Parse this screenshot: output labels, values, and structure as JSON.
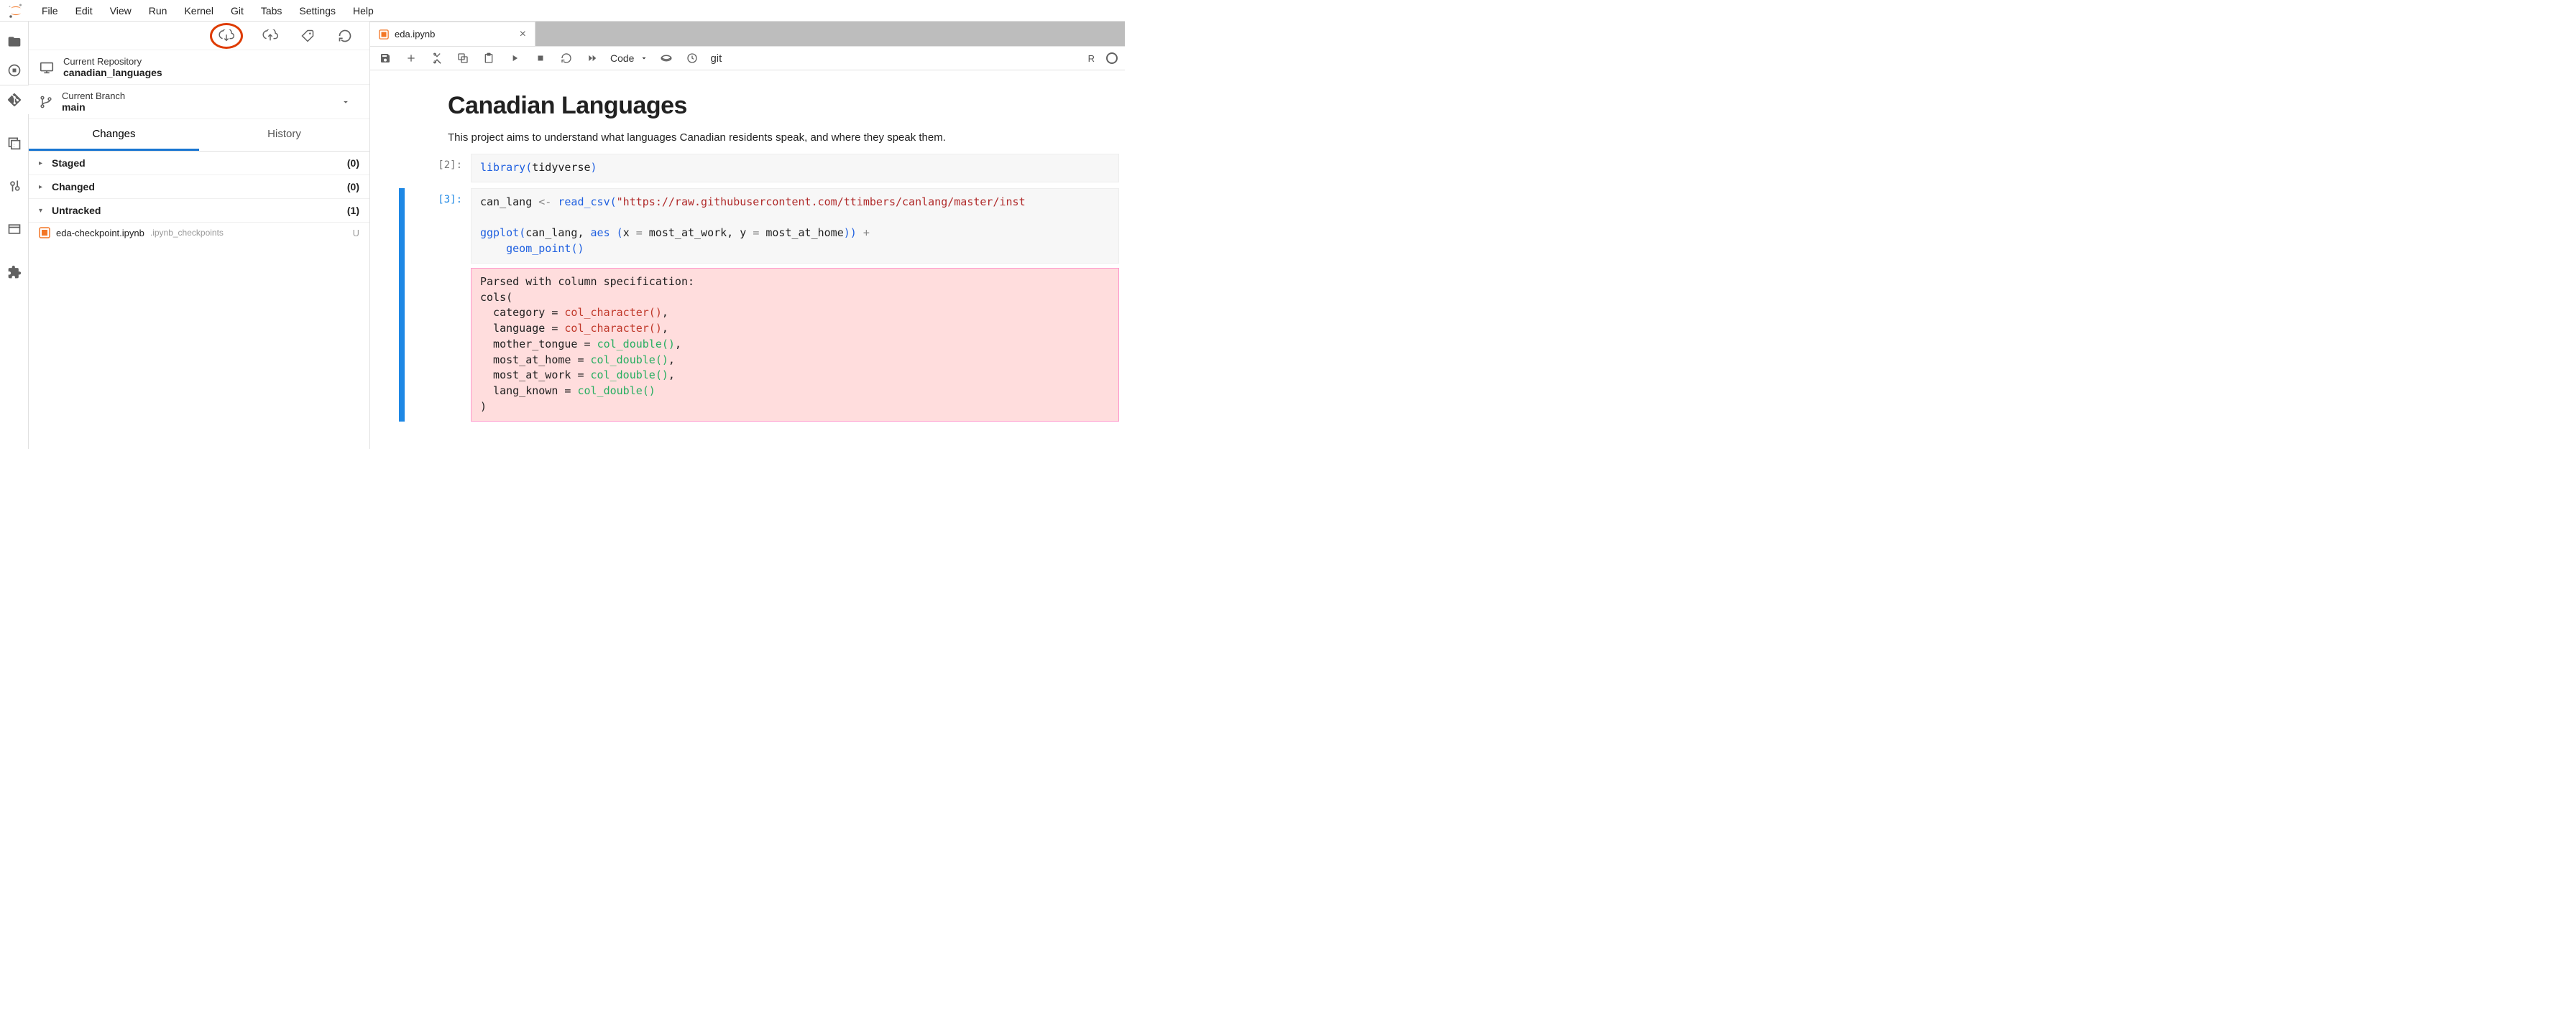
{
  "menubar": {
    "items": [
      "File",
      "Edit",
      "View",
      "Run",
      "Kernel",
      "Git",
      "Tabs",
      "Settings",
      "Help"
    ]
  },
  "git_panel": {
    "repo_label": "Current Repository",
    "repo_name": "canadian_languages",
    "branch_label": "Current Branch",
    "branch_name": "main",
    "tabs": {
      "changes": "Changes",
      "history": "History"
    },
    "sections": {
      "staged": {
        "title": "Staged",
        "count": "(0)",
        "expanded": true
      },
      "changed": {
        "title": "Changed",
        "count": "(0)",
        "expanded": true
      },
      "untracked": {
        "title": "Untracked",
        "count": "(1)",
        "expanded": true
      }
    },
    "untracked_files": [
      {
        "name": "eda-checkpoint.ipynb",
        "subdir": ".ipynb_checkpoints",
        "status": "U"
      }
    ]
  },
  "tab": {
    "title": "eda.ipynb"
  },
  "nb_toolbar": {
    "cell_type": "Code",
    "git_label": "git",
    "kernel_short": "R"
  },
  "notebook": {
    "title": "Canadian Languages",
    "intro": "This project aims to understand what languages Canadian residents speak, and where they speak them.",
    "cells": [
      {
        "prompt": "[2]:",
        "code_html": "<span class='tok-fn'>library</span><span class='tok-paren'>(</span>tidyverse<span class='tok-paren'>)</span>"
      },
      {
        "prompt": "[3]:",
        "active": true,
        "code_html": "can_lang <span class='tok-op'>&lt;-</span> <span class='tok-fn'>read_csv</span><span class='tok-paren'>(</span><span class='tok-str'>\"https://raw.githubusercontent.com/ttimbers/canlang/master/inst</span>\n\n<span class='tok-fn'>ggplot</span><span class='tok-paren'>(</span>can_lang, <span class='tok-fn'>aes</span> <span class='tok-paren'>(</span>x <span class='tok-op'>=</span> most_at_work, y <span class='tok-op'>=</span> most_at_home<span class='tok-paren'>))</span> <span class='tok-op'>+</span>\n    <span class='tok-fn'>geom_point</span><span class='tok-paren'>()</span>",
        "output_html": "Parsed with column specification:\ncols(\n  category = <span class='o-red'>col_character()</span>,\n  language = <span class='o-red'>col_character()</span>,\n  mother_tongue = <span class='o-grn'>col_double()</span>,\n  most_at_home = <span class='o-grn'>col_double()</span>,\n  most_at_work = <span class='o-grn'>col_double()</span>,\n  lang_known = <span class='o-grn'>col_double()</span>\n)"
      }
    ]
  }
}
